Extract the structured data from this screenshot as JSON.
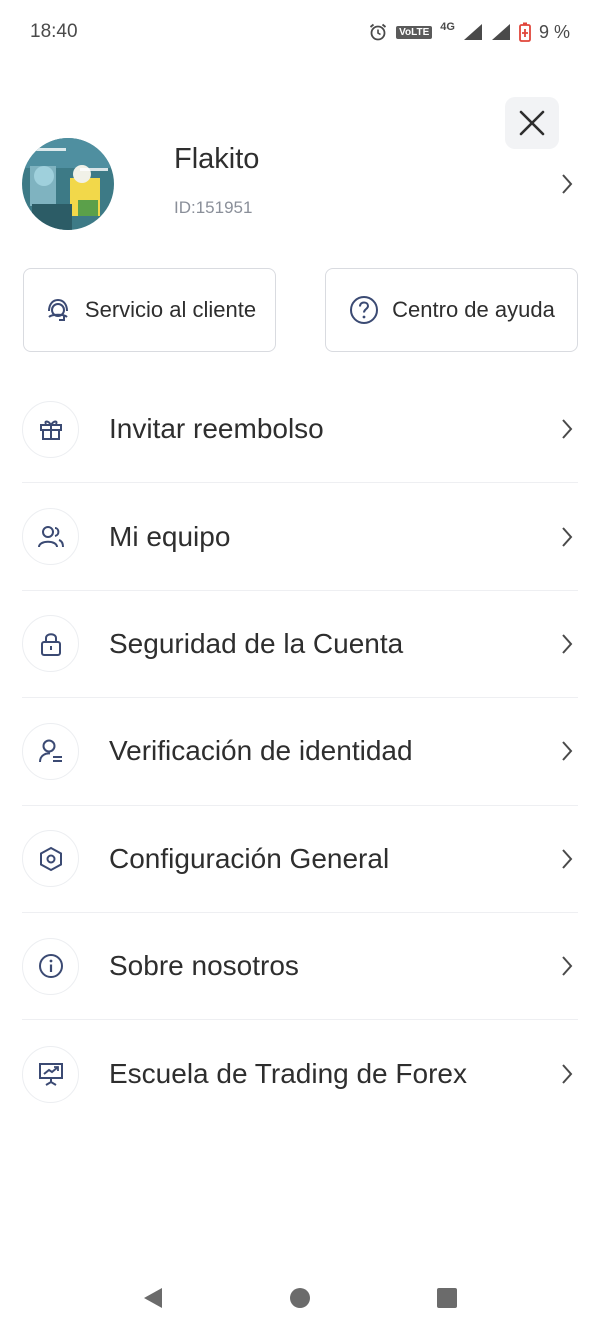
{
  "status_bar": {
    "time": "18:40",
    "volte": "VoLTE",
    "network": "4G",
    "battery": "9 %"
  },
  "profile": {
    "name": "Flakito",
    "id": "ID:151951"
  },
  "quick_actions": {
    "customer_service": "Servicio al cliente",
    "help_center": "Centro de ayuda"
  },
  "menu": {
    "items": [
      {
        "label": "Invitar reembolso",
        "icon": "gift-icon"
      },
      {
        "label": "Mi equipo",
        "icon": "team-icon"
      },
      {
        "label": "Seguridad de la Cuenta",
        "icon": "lock-icon"
      },
      {
        "label": "Verificación de identidad",
        "icon": "user-verify-icon"
      },
      {
        "label": "Configuración General",
        "icon": "hexagon-settings-icon"
      },
      {
        "label": "Sobre nosotros",
        "icon": "info-icon"
      },
      {
        "label": "Escuela de Trading de Forex",
        "icon": "presentation-chart-icon"
      }
    ]
  },
  "colors": {
    "text": "#2e2e2e",
    "muted": "#8a8f99",
    "border": "#d9dbe0",
    "icon_accent": "#3b4a73",
    "battery_red": "#e0453a"
  }
}
